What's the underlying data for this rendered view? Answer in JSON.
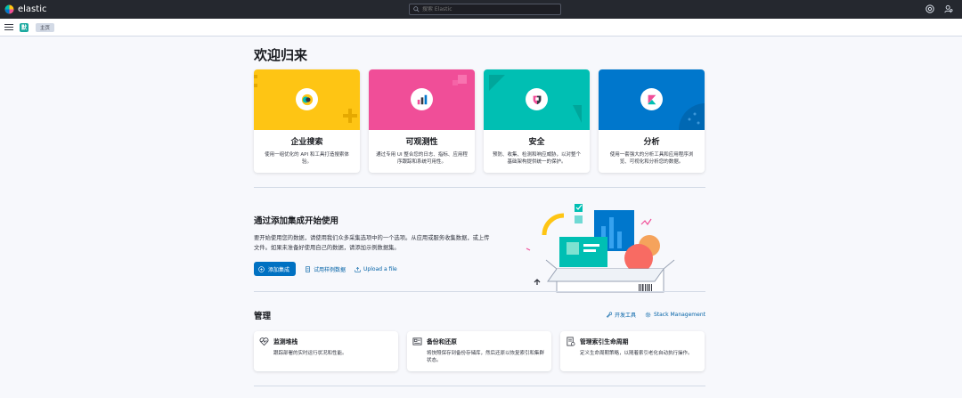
{
  "app": {
    "brand": "elastic"
  },
  "search": {
    "placeholder": "搜索 Elastic"
  },
  "subbar": {
    "space_letter": "默",
    "breadcrumb": "主页"
  },
  "page": {
    "title": "欢迎归来"
  },
  "solutions": [
    {
      "title": "企业搜索",
      "desc": "使用一组优化的 API 和工具打造搜索体验。",
      "color": "#fec514"
    },
    {
      "title": "可观测性",
      "desc": "通过专用 UI 整合您的日志、指标、应用程序跟踪和系统可用性。",
      "color": "#f04e98"
    },
    {
      "title": "安全",
      "desc": "预防、收集、检测和响应威胁，以对整个基础架构提供统一的保护。",
      "color": "#00bfb3"
    },
    {
      "title": "分析",
      "desc": "使用一套强大的分析工具和应用程序浏览、可视化和分析您的数据。",
      "color": "#0077cc"
    }
  ],
  "integrations": {
    "title": "通过添加集成开始使用",
    "desc": "要开始使用您的数据，请使用我们众多采集选项中的一个选项。从应用或服务收集数据，或上传文件。如果未准备好使用自己的数据，请添加示例数据集。",
    "add_label": "添加集成",
    "sample_label": "试用样例数据",
    "upload_label": "Upload a file"
  },
  "management": {
    "title": "管理",
    "dev_tools": "开发工具",
    "stack_mgmt": "Stack Management",
    "cards": [
      {
        "title": "监测堆栈",
        "desc": "跟踪部署的实时运行状况和性能。",
        "icon": "heartbeat-icon"
      },
      {
        "title": "备份和还原",
        "desc": "将快照保存到备份存储库，然后还原以恢复索引和集群状态。",
        "icon": "backup-icon"
      },
      {
        "title": "管理索引生命周期",
        "desc": "定义生命周期策略，以随着索引老化自动执行操作。",
        "icon": "lifecycle-icon"
      }
    ]
  },
  "colors": {
    "topbar": "#25282f",
    "primary": "#0071c2",
    "link": "#0061a6"
  }
}
